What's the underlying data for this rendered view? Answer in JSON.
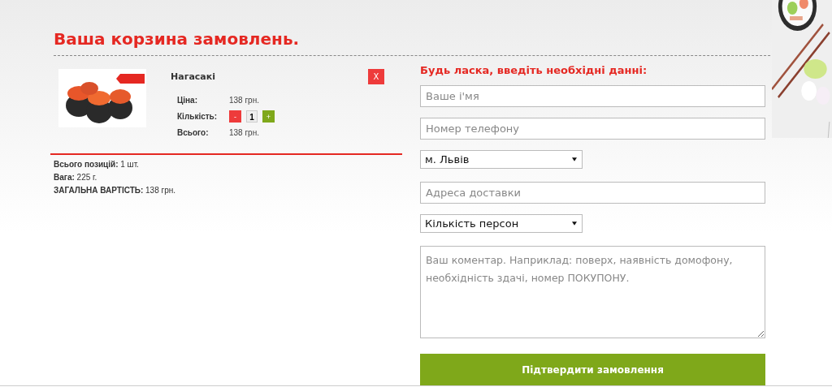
{
  "cart": {
    "title": "Ваша корзина замовлень.",
    "items": [
      {
        "kind": "picture",
        "name": "Нагасакі",
        "remove": "X",
        "fields": [
          {
            "kind": "text",
            "label": "Ціна:",
            "value": "138 грн."
          },
          {
            "kind": "qty",
            "label": "Кількість:",
            "minus": "-",
            "value": "1",
            "plus": "+"
          },
          {
            "kind": "text",
            "label": "Всього:",
            "value": "138 грн."
          }
        ]
      }
    ],
    "summary": [
      "**Всього позицій:** 1 шт.",
      "**Вага:** 225 г.",
      "**ЗАГАЛЬНА ВАРТІСТЬ:** 138 грн."
    ]
  },
  "form": {
    "title": "Будь ласка, введіть необхідні данні:",
    "fields": [
      {
        "kind": "input",
        "placeholder": "Ваше і'мя"
      },
      {
        "kind": "input",
        "placeholder": "Номер телефону"
      },
      {
        "kind": "select",
        "value": "м. Львів"
      },
      {
        "kind": "input",
        "placeholder": "Адреса доставки"
      },
      {
        "kind": "select",
        "value": "Кількість персон"
      },
      {
        "kind": "textarea",
        "placeholder": "Ваш коментар. Наприклад: поверх, наявність домофону, необхідність здачі, номер ПОКУПОНУ."
      }
    ],
    "submit": "Підтвердити замовлення"
  }
}
